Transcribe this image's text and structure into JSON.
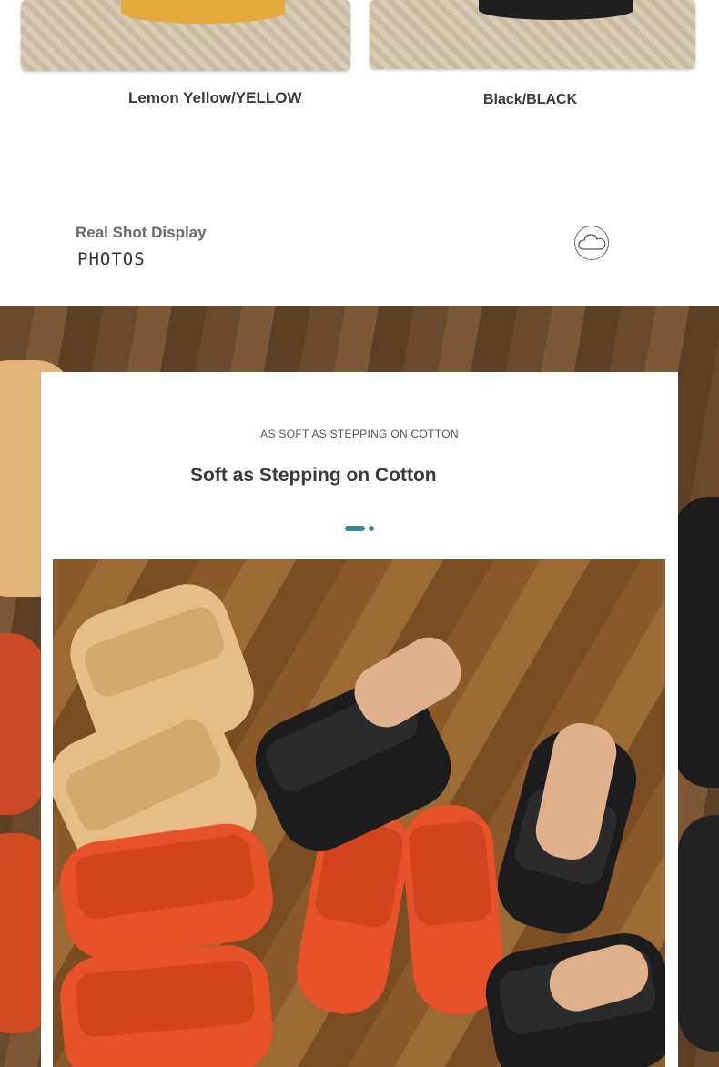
{
  "variants": [
    {
      "label": "Lemon Yellow/YELLOW"
    },
    {
      "label": "Black/BLACK"
    }
  ],
  "section": {
    "title": "Real Shot Display",
    "subtitle": "PHOTOS",
    "icon": "cloud-icon"
  },
  "feature": {
    "eyebrow": "AS SOFT AS STEPPING ON COTTON",
    "headline": "Soft as Stepping on Cotton"
  },
  "colors": {
    "accent": "#3d8a8a",
    "text": "#3a3a3a"
  }
}
